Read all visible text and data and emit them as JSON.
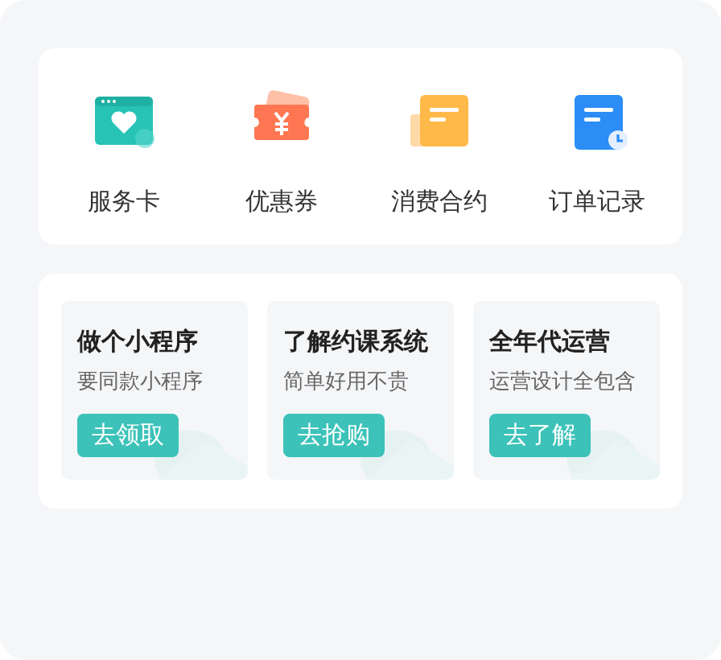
{
  "services": [
    {
      "kind": "card",
      "label": "服务卡"
    },
    {
      "kind": "coupon",
      "label": "优惠券"
    },
    {
      "kind": "contract",
      "label": "消费合约"
    },
    {
      "kind": "order",
      "label": "订单记录"
    }
  ],
  "promos": [
    {
      "title": "做个小程序",
      "subtitle": "要同款小程序",
      "button": "去领取"
    },
    {
      "title": "了解约课系统",
      "subtitle": "简单好用不贵",
      "button": "去抢购"
    },
    {
      "title": "全年代运营",
      "subtitle": "运营设计全包含",
      "button": "去了解"
    }
  ]
}
